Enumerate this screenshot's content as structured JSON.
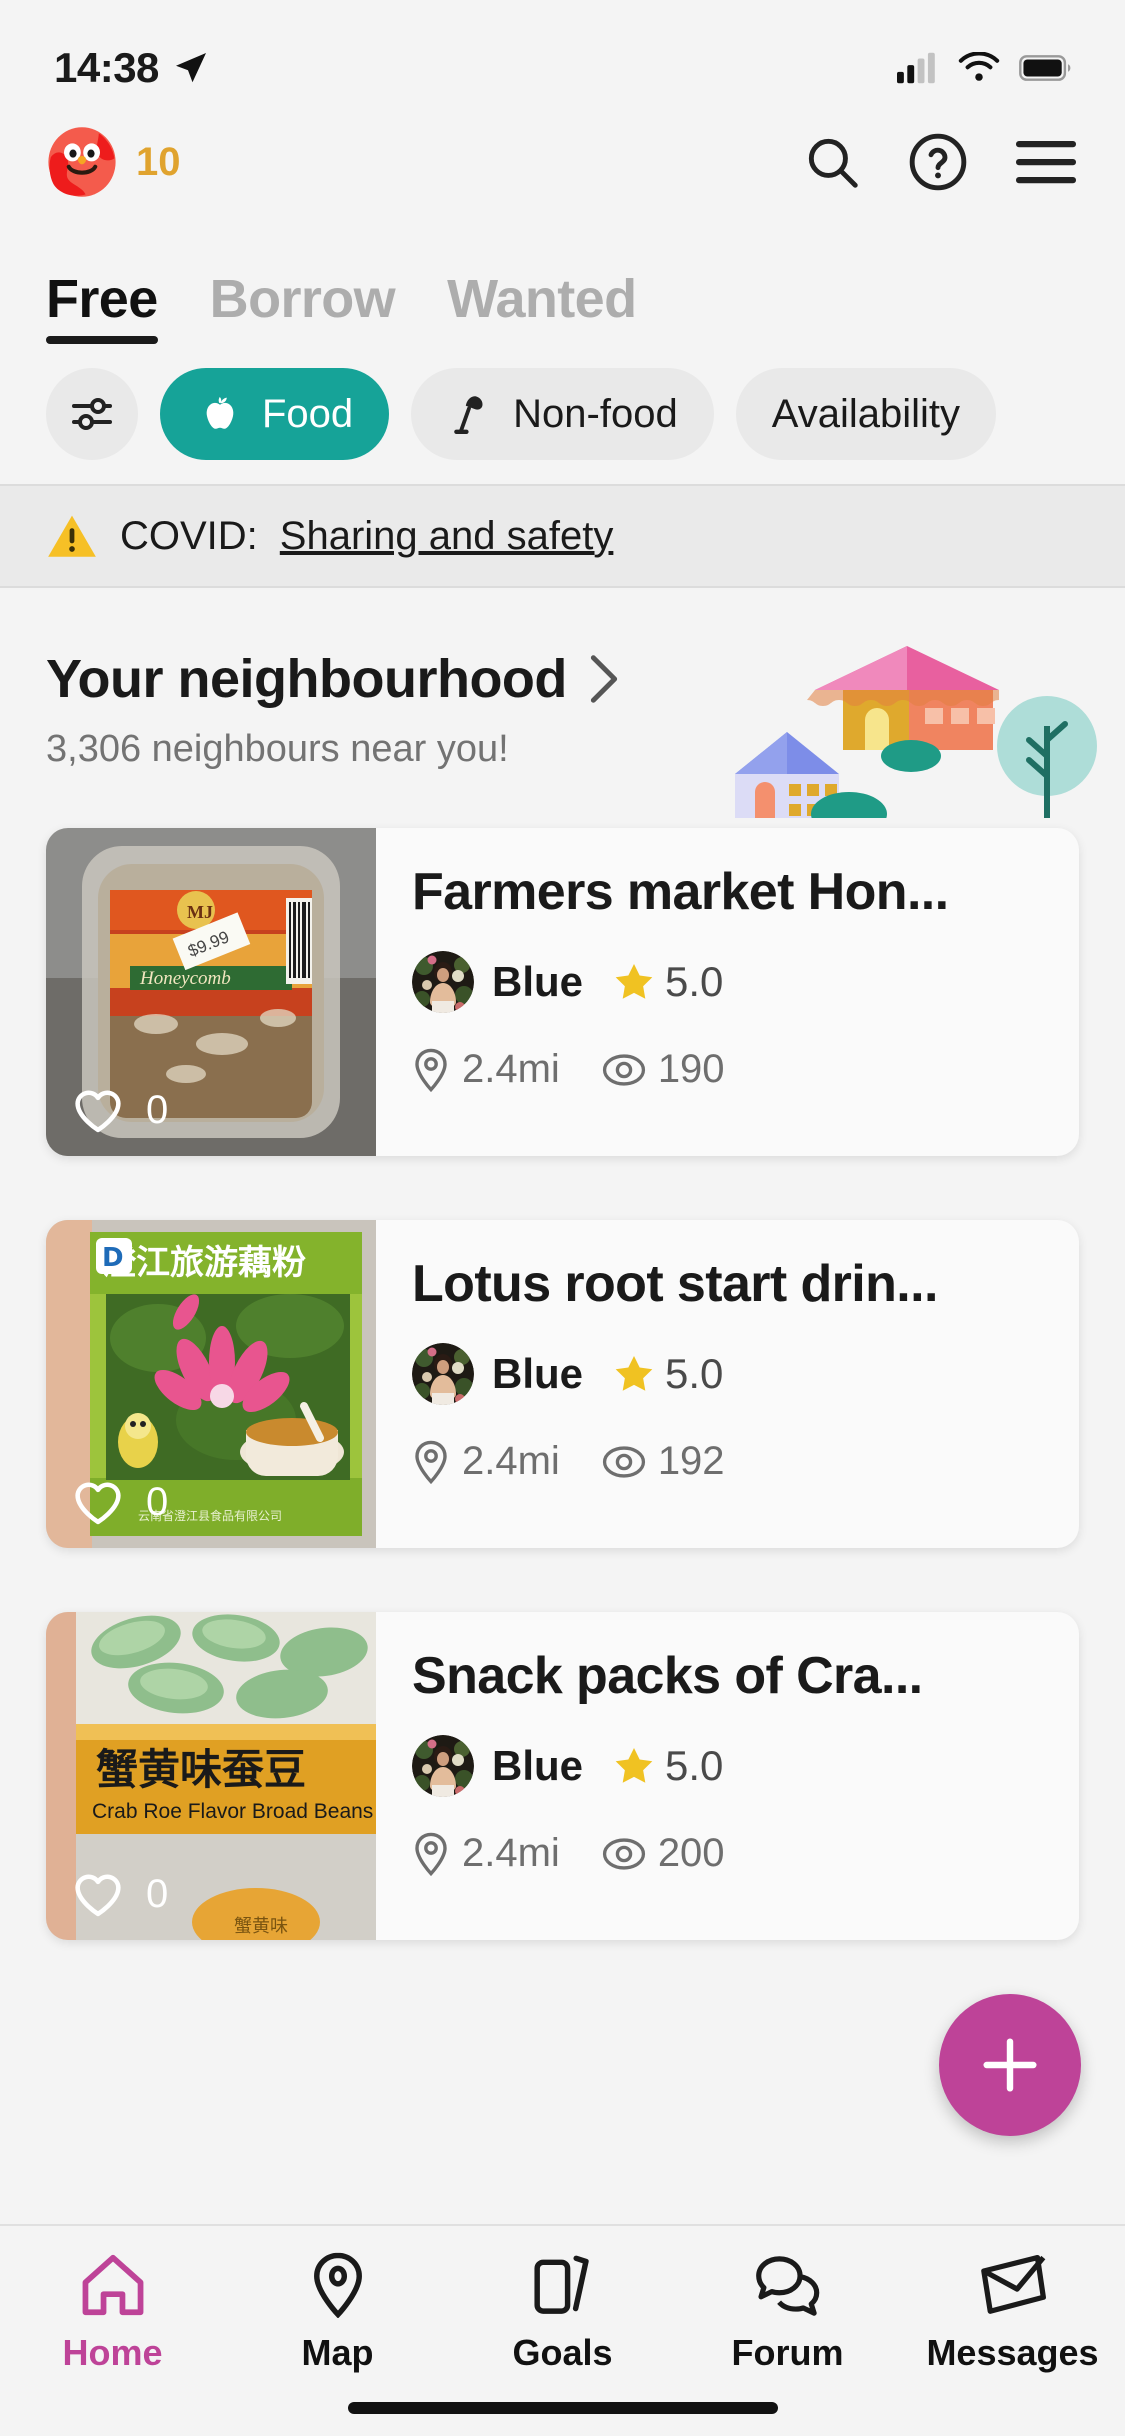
{
  "status_bar": {
    "time": "14:38",
    "location_icon": "location-arrow-icon",
    "signal_icon": "cellular-signal-icon",
    "wifi_icon": "wifi-icon",
    "battery_icon": "battery-full-icon"
  },
  "header": {
    "logo_icon": "olio-mascot-logo",
    "count": "10",
    "count_color": "#E0A32E",
    "search_icon": "search-icon",
    "help_icon": "help-circle-icon",
    "menu_icon": "hamburger-menu-icon"
  },
  "tabs": [
    {
      "label": "Free",
      "active": true
    },
    {
      "label": "Borrow",
      "active": false
    },
    {
      "label": "Wanted",
      "active": false
    }
  ],
  "filter_chips": {
    "settings_icon": "filter-sliders-icon",
    "items": [
      {
        "label": "Food",
        "icon": "apple-icon",
        "active": true
      },
      {
        "label": "Non-food",
        "icon": "lamp-icon",
        "active": false
      },
      {
        "label": "Availability",
        "icon": "",
        "active": false
      }
    ],
    "active_color": "#16A398",
    "inactive_color": "#E9E9E9"
  },
  "covid_banner": {
    "warning_icon": "warning-triangle-icon",
    "label": "COVID:",
    "link_text": "Sharing and safety"
  },
  "neighbourhood": {
    "title": "Your neighbourhood",
    "chevron_icon": "chevron-right-icon",
    "subtitle": "3,306 neighbours near you!",
    "illustration": "houses-and-tree-illustration"
  },
  "listings": [
    {
      "title": "Farmers market Hon...",
      "user": "Blue",
      "rating": "5.0",
      "star_icon": "star-icon",
      "distance": "2.4mi",
      "distance_icon": "location-pin-icon",
      "views": "190",
      "views_icon": "eye-icon",
      "likes": "0",
      "like_icon": "heart-outline-icon",
      "image": "honeycomb-container-photo"
    },
    {
      "title": "Lotus root start drin...",
      "user": "Blue",
      "rating": "5.0",
      "star_icon": "star-icon",
      "distance": "2.4mi",
      "distance_icon": "location-pin-icon",
      "views": "192",
      "views_icon": "eye-icon",
      "likes": "0",
      "like_icon": "heart-outline-icon",
      "image": "lotus-root-drink-box-photo"
    },
    {
      "title": "Snack packs of Cra...",
      "user": "Blue",
      "rating": "5.0",
      "star_icon": "star-icon",
      "distance": "2.4mi",
      "distance_icon": "location-pin-icon",
      "views": "200",
      "views_icon": "eye-icon",
      "likes": "0",
      "like_icon": "heart-outline-icon",
      "image": "crab-roe-broad-beans-photo"
    }
  ],
  "fab": {
    "icon": "plus-icon",
    "color": "#BE4398"
  },
  "bottom_nav": {
    "active_color": "#BE4398",
    "items": [
      {
        "label": "Home",
        "icon": "home-icon",
        "active": true
      },
      {
        "label": "Map",
        "icon": "map-pin-icon",
        "active": false
      },
      {
        "label": "Goals",
        "icon": "cards-stack-icon",
        "active": false
      },
      {
        "label": "Forum",
        "icon": "chat-bubbles-icon",
        "active": false
      },
      {
        "label": "Messages",
        "icon": "envelope-icon",
        "active": false
      }
    ]
  }
}
